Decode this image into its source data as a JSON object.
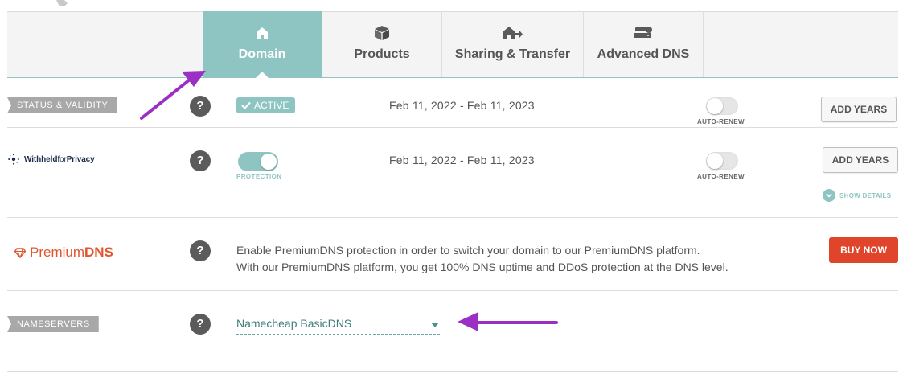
{
  "tabs": [
    {
      "label": "Domain",
      "icon": "house-icon",
      "active": true
    },
    {
      "label": "Products",
      "icon": "box-icon",
      "active": false
    },
    {
      "label": "Sharing & Transfer",
      "icon": "transfer-house-icon",
      "active": false
    },
    {
      "label": "Advanced DNS",
      "icon": "dns-server-icon",
      "active": false
    }
  ],
  "status": {
    "label": "STATUS & VALIDITY",
    "help": "?",
    "badge": "ACTIVE",
    "dates": "Feb 11, 2022 - Feb 11, 2023",
    "autorenew_label": "AUTO-RENEW",
    "autorenew_on": false,
    "button": "ADD YEARS"
  },
  "privacy": {
    "brand_a": "Withheld",
    "brand_b": "for",
    "brand_c": "Privacy",
    "help": "?",
    "protection_label": "PROTECTION",
    "protection_on": true,
    "dates": "Feb 11, 2022 - Feb 11, 2023",
    "autorenew_label": "AUTO-RENEW",
    "autorenew_on": false,
    "button": "ADD YEARS",
    "show_details": "SHOW DETAILS"
  },
  "premium": {
    "brand_a": "Premium",
    "brand_b": "DNS",
    "help": "?",
    "line1": "Enable PremiumDNS protection in order to switch your domain to our PremiumDNS platform.",
    "line2": "With our PremiumDNS platform, you get 100% DNS uptime and DDoS protection at the DNS level.",
    "button": "BUY NOW"
  },
  "nameservers": {
    "label": "NAMESERVERS",
    "help": "?",
    "selected": "Namecheap BasicDNS"
  },
  "colors": {
    "teal": "#8ec5c2",
    "buy": "#e0442a",
    "annotation": "#9b2fc4"
  }
}
